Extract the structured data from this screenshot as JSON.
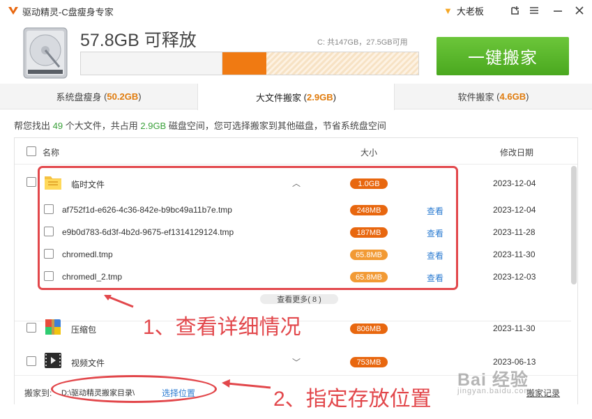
{
  "window": {
    "title": "驱动精灵-C盘瘦身专家",
    "vip_label": "大老板"
  },
  "header": {
    "free_space": "57.8GB 可释放",
    "disk_info": "C: 共147GB，27.5GB可用",
    "move_button": "一键搬家",
    "usage_bar": {
      "used_fraction": 0.42,
      "releasable_fraction": 0.13,
      "free_fraction": 0.45
    }
  },
  "tabs": [
    {
      "label": "系统盘瘦身",
      "size": "50.2GB"
    },
    {
      "label": "大文件搬家",
      "size": "2.9GB"
    },
    {
      "label": "软件搬家",
      "size": "4.6GB"
    }
  ],
  "summary": {
    "p1": "帮您找出",
    "count": "49",
    "p2": "个大文件，共占用",
    "total": "2.9GB",
    "p3": "磁盘空间，您可选择搬家到其他磁盘，节省系统盘空间"
  },
  "columns": {
    "name": "名称",
    "size": "大小",
    "date": "修改日期"
  },
  "groups": [
    {
      "name": "临时文件",
      "size": "1.0GB",
      "date": "2023-12-04",
      "icon": "folder-icon"
    },
    {
      "name": "压缩包",
      "size": "806MB",
      "date": "2023-11-30",
      "icon": "archive-icon"
    },
    {
      "name": "视频文件",
      "size": "753MB",
      "date": "2023-06-13",
      "icon": "video-icon"
    }
  ],
  "files": [
    {
      "name": "af752f1d-e626-4c36-842e-b9bc49a11b7e.tmp",
      "size": "248MB",
      "date": "2023-12-04",
      "action": "查看"
    },
    {
      "name": "e9b0d783-6d3f-4b2d-9675-ef1314129124.tmp",
      "size": "187MB",
      "date": "2023-11-28",
      "action": "查看"
    },
    {
      "name": "chromedl.tmp",
      "size": "65.8MB",
      "date": "2023-11-30",
      "action": "查看"
    },
    {
      "name": "chromedl_2.tmp",
      "size": "65.8MB",
      "date": "2023-12-03",
      "action": "查看"
    }
  ],
  "more": "查看更多( 8 )",
  "footer": {
    "label": "搬家到:",
    "path": "D:\\驱动精灵搬家目录\\",
    "choose": "选择位置",
    "record": "搬家记录"
  },
  "annotations": {
    "step1": "1、查看详细情况",
    "step2": "2、指定存放位置",
    "color": "#e2474b"
  },
  "watermark": {
    "brand": "Bai 经验",
    "url": "jingyan.baidu.com"
  },
  "colors": {
    "accent_green": "#4aa81f",
    "orange": "#e8670f",
    "link": "#2b7bd1"
  }
}
